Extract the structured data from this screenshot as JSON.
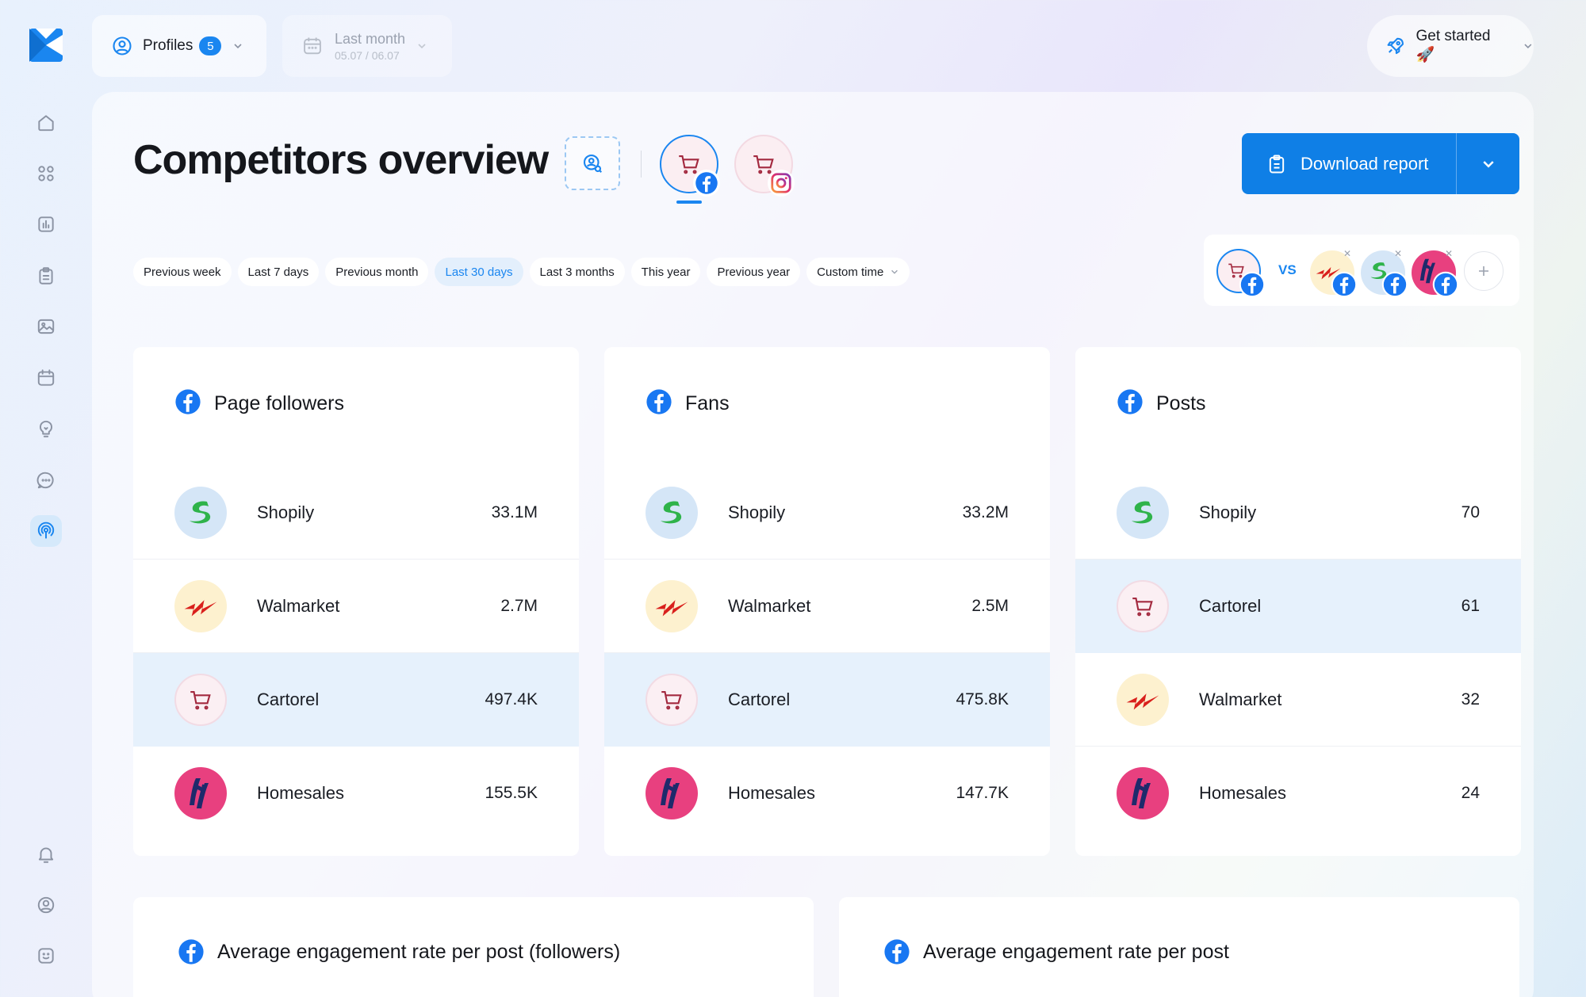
{
  "topbar": {
    "profiles_label": "Profiles",
    "profiles_count": "5",
    "date_label": "Last month",
    "date_range": "05.07 / 06.07",
    "get_started_label": "Get started 🚀"
  },
  "header": {
    "title": "Competitors overview",
    "download_label": "Download report",
    "vs_label": "VS"
  },
  "time_filters": [
    {
      "label": "Previous week",
      "active": false
    },
    {
      "label": "Last 7 days",
      "active": false
    },
    {
      "label": "Previous month",
      "active": false
    },
    {
      "label": "Last 30 days",
      "active": true
    },
    {
      "label": "Last 3 months",
      "active": false
    },
    {
      "label": "This year",
      "active": false
    },
    {
      "label": "Previous year",
      "active": false
    },
    {
      "label": "Custom time",
      "active": false
    }
  ],
  "cards": [
    {
      "title": "Page followers",
      "rows": [
        {
          "name": "Shopily",
          "value": "33.1M",
          "brand": "shopily",
          "highlight": false
        },
        {
          "name": "Walmarket",
          "value": "2.7M",
          "brand": "walmarket",
          "highlight": false
        },
        {
          "name": "Cartorel",
          "value": "497.4K",
          "brand": "cartorel",
          "highlight": true
        },
        {
          "name": "Homesales",
          "value": "155.5K",
          "brand": "homesales",
          "highlight": false
        }
      ]
    },
    {
      "title": "Fans",
      "rows": [
        {
          "name": "Shopily",
          "value": "33.2M",
          "brand": "shopily",
          "highlight": false
        },
        {
          "name": "Walmarket",
          "value": "2.5M",
          "brand": "walmarket",
          "highlight": false
        },
        {
          "name": "Cartorel",
          "value": "475.8K",
          "brand": "cartorel",
          "highlight": true
        },
        {
          "name": "Homesales",
          "value": "147.7K",
          "brand": "homesales",
          "highlight": false
        }
      ]
    },
    {
      "title": "Posts",
      "rows": [
        {
          "name": "Shopily",
          "value": "70",
          "brand": "shopily",
          "highlight": false
        },
        {
          "name": "Cartorel",
          "value": "61",
          "brand": "cartorel",
          "highlight": true
        },
        {
          "name": "Walmarket",
          "value": "32",
          "brand": "walmarket",
          "highlight": false
        },
        {
          "name": "Homesales",
          "value": "24",
          "brand": "homesales",
          "highlight": false
        }
      ]
    }
  ],
  "bottom_cards": [
    {
      "title": "Average engagement rate per post (followers)"
    },
    {
      "title": "Average engagement rate per post"
    }
  ],
  "colors": {
    "accent": "#1a86f0",
    "facebook": "#1877f2",
    "homesales": "#e8407f",
    "walmarket_red": "#d9201c",
    "shopily_green": "#2fb34a"
  },
  "icons": {
    "sidebar": [
      "home-icon",
      "apps-grid-icon",
      "analytics-icon",
      "clipboard-icon",
      "image-icon",
      "calendar-icon",
      "lightbulb-icon",
      "chat-icon",
      "broadcast-icon",
      "bell-icon",
      "user-circle-icon",
      "smiley-icon"
    ]
  }
}
